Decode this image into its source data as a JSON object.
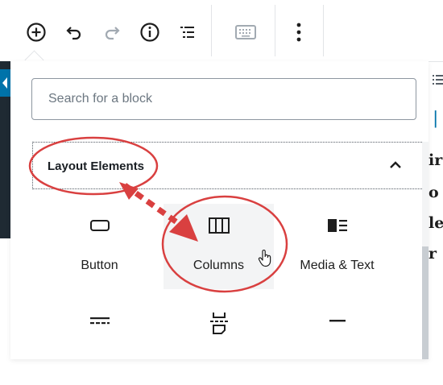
{
  "toolbar": {
    "buttons": [
      {
        "name": "add-block-button",
        "icon": "plus-circle-icon"
      },
      {
        "name": "undo-button",
        "icon": "undo-icon"
      },
      {
        "name": "redo-button",
        "icon": "redo-icon"
      },
      {
        "name": "info-button",
        "icon": "info-icon"
      },
      {
        "name": "outline-button",
        "icon": "list-icon"
      },
      {
        "name": "keyboard-button",
        "icon": "keyboard-icon"
      },
      {
        "name": "more-options-button",
        "icon": "more-vertical-icon"
      }
    ]
  },
  "inserter": {
    "search_placeholder": "Search for a block",
    "panel_title": "Layout Elements",
    "blocks": [
      {
        "label": "Button",
        "icon": "button-icon"
      },
      {
        "label": "Columns",
        "icon": "columns-icon"
      },
      {
        "label": "Media & Text",
        "icon": "media-text-icon"
      },
      {
        "label": "",
        "icon": "more-icon"
      },
      {
        "label": "",
        "icon": "page-break-icon"
      },
      {
        "label": "",
        "icon": "separator-icon"
      }
    ]
  },
  "background_text": [
    "ir",
    "o",
    "le",
    "r"
  ],
  "colors": {
    "accent": "#0073aa",
    "annotation": "#d94040",
    "border": "#8d96a0"
  }
}
